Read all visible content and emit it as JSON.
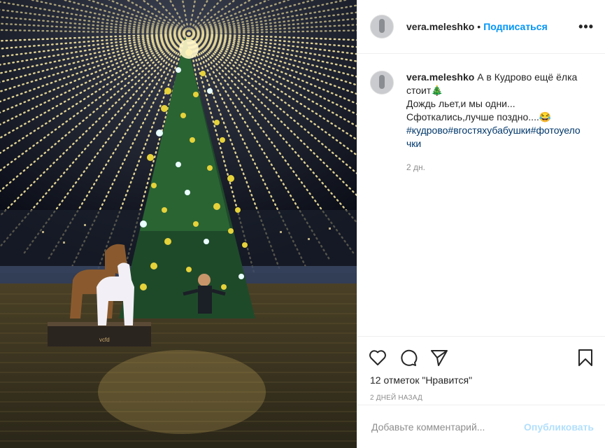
{
  "post": {
    "username": "vera.meleshko",
    "follow_label": "Подписаться",
    "dot": "•",
    "more": "•••"
  },
  "caption": {
    "username": "vera.meleshko",
    "line1": "А в Кудрово ещё ёлка стоит🎄",
    "line2": "Дождь льет,и мы одни...",
    "line3": "Сфоткались,лучше поздно....😂",
    "hashtags": "#кудрово#вгостяхубабушки#фотоуелочки",
    "time": "2 дн."
  },
  "actions": {
    "likes": "12 отметок \"Нравится\"",
    "time_ago": "2 ДНЕЙ НАЗАД"
  },
  "comment_box": {
    "placeholder": "Добавьте комментарий...",
    "publish_label": "Опубликовать"
  },
  "photo": {
    "horse_sign": "vcfd"
  },
  "colors": {
    "follow": "#0095f6",
    "publish_disabled": "#b2dffc",
    "hashtag": "#00376b",
    "muted": "#8e8e8e"
  }
}
